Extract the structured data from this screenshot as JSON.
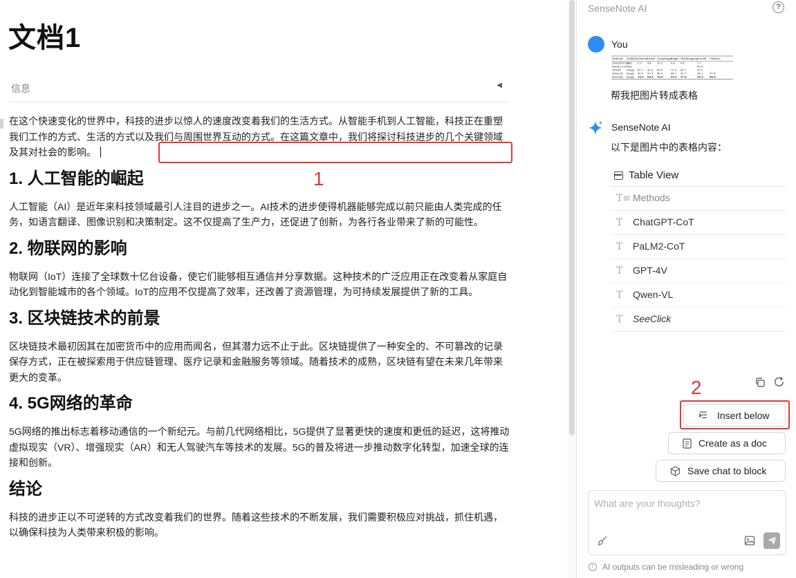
{
  "document": {
    "title": "文档1",
    "info_label": "信息",
    "intro": "在这个快速变化的世界中，科技的进步以惊人的速度改变着我们的生活方式。从智能手机到人工智能，科技正在重塑我们工作的方式、生活的方式以及我们与周围世界互动的方式。在这篇文章中，我们将探讨科技进步的几个关键领域及其对社会的影响。",
    "sections": [
      {
        "heading": "1. 人工智能的崛起",
        "body": "人工智能（AI）是近年来科技领域最引人注目的进步之一。AI技术的进步使得机器能够完成以前只能由人类完成的任务，如语言翻译、图像识别和决策制定。这不仅提高了生产力，还促进了创新，为各行各业带来了新的可能性。"
      },
      {
        "heading": "2. 物联网的影响",
        "body": "物联网（IoT）连接了全球数十亿台设备，使它们能够相互通信并分享数据。这种技术的广泛应用正在改变着从家庭自动化到智能城市的各个领域。IoT的应用不仅提高了效率，还改善了资源管理，为可持续发展提供了新的工具。"
      },
      {
        "heading": "3. 区块链技术的前景",
        "body": "区块链技术最初因其在加密货币中的应用而闻名，但其潜力远不止于此。区块链提供了一种安全的、不可篡改的记录保存方式，正在被探索用于供应链管理、医疗记录和金融服务等领域。随着技术的成熟，区块链有望在未来几年带来更大的变革。"
      },
      {
        "heading": "4. 5G网络的革命",
        "body": "5G网络的推出标志着移动通信的一个新纪元。与前几代网络相比，5G提供了显著更快的速度和更低的延迟，这将推动虚拟现实（VR）、增强现实（AR）和无人驾驶汽车等技术的发展。5G的普及将进一步推动数字化转型，加速全球的连接和创新。"
      },
      {
        "heading": "结论",
        "body": "科技的进步正以不可逆转的方式改变着我们的世界。随着这些技术的不断发展，我们需要积极应对挑战，抓住机遇，以确保科技为人类带来积极的影响。"
      }
    ]
  },
  "annotations": {
    "label_1": "1",
    "label_2": "2",
    "box_color": "#e53935"
  },
  "panel": {
    "title": "SenseNote AI",
    "help_icon": "help-circle-icon",
    "user": {
      "name": "You",
      "message": "帮我把图片转成表格"
    },
    "ai": {
      "name": "SenseNote AI",
      "message": "以下是图片中的表格内容：",
      "star_color": "#2f8cf0"
    },
    "table_view": {
      "label": "Table View",
      "rows": [
        "Methods",
        "ChatGPT-CoT",
        "PaLM2-CoT",
        "GPT-4V",
        "Qwen-VL",
        "SeeClick"
      ]
    },
    "thumbnail": {
      "headers": [
        "Methods",
        "Modality",
        "General",
        "Install",
        "GoogleApps",
        "Single",
        "WebShopping",
        "Overall",
        "ClickAcc"
      ],
      "rows": [
        [
          "ChatGPT-CoT",
          "Text",
          "5.9",
          "4.4",
          "10.5",
          "9.4",
          "8.4",
          "7.7",
          "-"
        ],
        [
          "PaLM2-CoT",
          "Text",
          "-",
          "-",
          "-",
          "-",
          "-",
          "39.6",
          "-"
        ],
        [
          "GPT-4V",
          "Image",
          "41.7",
          "42.6",
          "49.8",
          "72.8",
          "45.7",
          "50.5",
          "-"
        ],
        [
          "Qwen-VL",
          "Image",
          "49.5",
          "59.9",
          "46.9",
          "64.7",
          "50.7",
          "54.3",
          "57.4"
        ],
        [
          "SeeClick",
          "Image",
          "54.0",
          "66.4",
          "54.9",
          "63.5",
          "57.6",
          "59.3",
          "66.4"
        ]
      ]
    },
    "actions": {
      "insert_below": "Insert below",
      "create_doc": "Create as a doc",
      "save_chat": "Save chat to block"
    },
    "input": {
      "placeholder": "What are your thoughts?",
      "value": ""
    },
    "disclaimer": "AI outputs can be misleading or wrong"
  }
}
